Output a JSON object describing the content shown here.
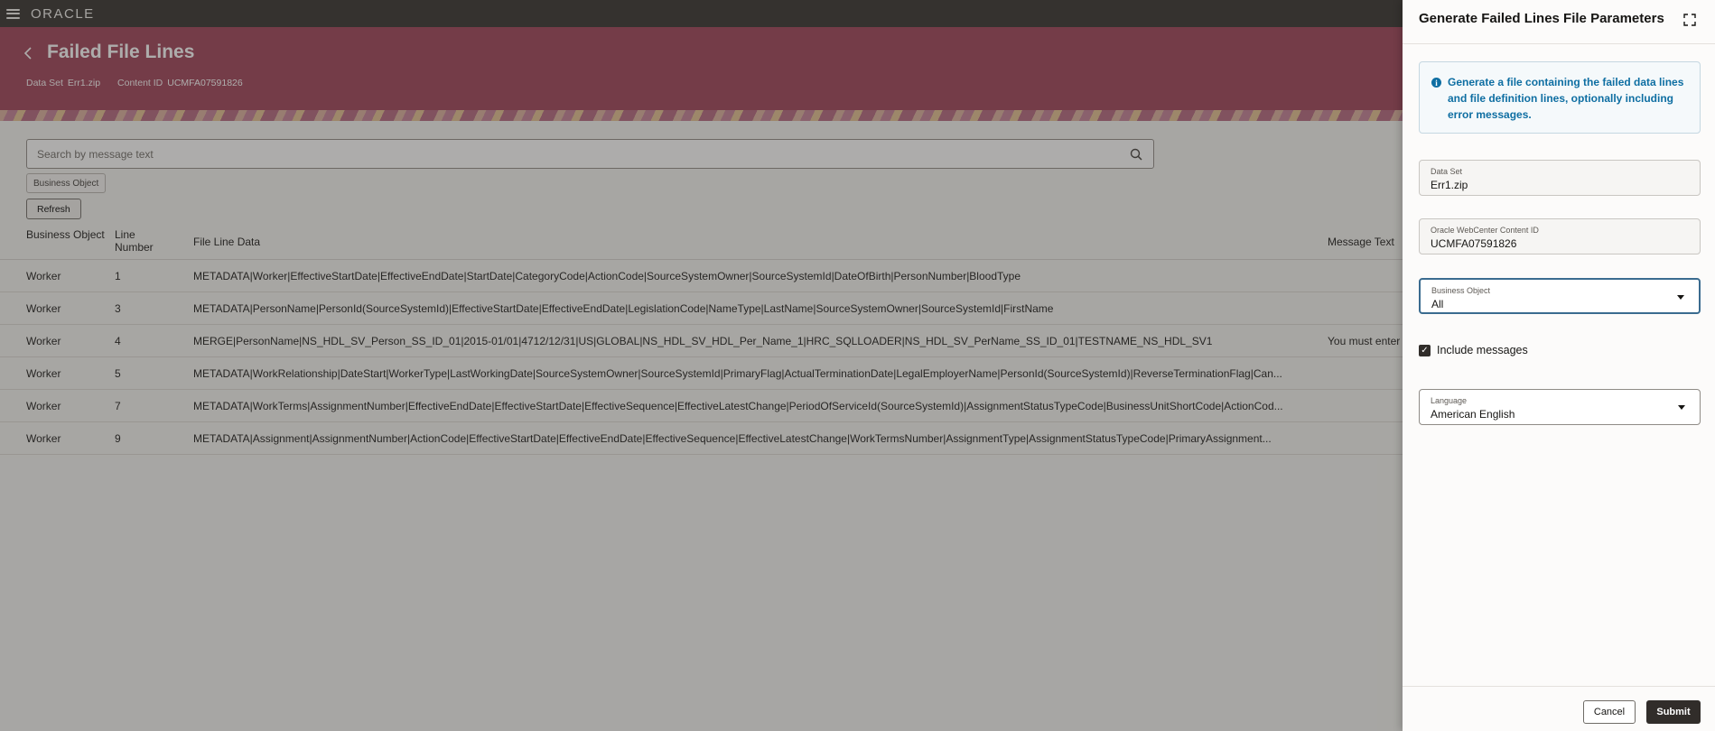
{
  "topbar": {
    "logo_text": "ORACLE"
  },
  "header": {
    "back_icon": "chevron-left-icon",
    "title": "Failed File Lines",
    "data_set_label": "Data Set",
    "data_set_value": "Err1.zip",
    "content_id_label": "Content ID",
    "content_id_value": "UCMFA07591826"
  },
  "search": {
    "placeholder": "Search by message text",
    "icon": "search-icon"
  },
  "filter_chip": "Business Object",
  "refresh_label": "Refresh",
  "table": {
    "headers": {
      "business_object": "Business Object",
      "line_number": "Line Number",
      "file_line_data": "File Line Data",
      "message_text": "Message Text"
    },
    "rows": [
      {
        "business_object": "Worker",
        "line_number": "1",
        "file_line_data": "METADATA|Worker|EffectiveStartDate|EffectiveEndDate|StartDate|CategoryCode|ActionCode|SourceSystemOwner|SourceSystemId|DateOfBirth|PersonNumber|BloodType",
        "message_text": ""
      },
      {
        "business_object": "Worker",
        "line_number": "3",
        "file_line_data": "METADATA|PersonName|PersonId(SourceSystemId)|EffectiveStartDate|EffectiveEndDate|LegislationCode|NameType|LastName|SourceSystemOwner|SourceSystemId|FirstName",
        "message_text": ""
      },
      {
        "business_object": "Worker",
        "line_number": "4",
        "file_line_data": "MERGE|PersonName|NS_HDL_SV_Person_SS_ID_01|2015-01/01|4712/12/31|US|GLOBAL|NS_HDL_SV_HDL_Per_Name_1|HRC_SQLLOADER|NS_HDL_SV_PerName_SS_ID_01|TESTNAME_NS_HDL_SV1",
        "message_text": "You must enter"
      },
      {
        "business_object": "Worker",
        "line_number": "5",
        "file_line_data": "METADATA|WorkRelationship|DateStart|WorkerType|LastWorkingDate|SourceSystemOwner|SourceSystemId|PrimaryFlag|ActualTerminationDate|LegalEmployerName|PersonId(SourceSystemId)|ReverseTerminationFlag|Can...",
        "message_text": ""
      },
      {
        "business_object": "Worker",
        "line_number": "7",
        "file_line_data": "METADATA|WorkTerms|AssignmentNumber|EffectiveEndDate|EffectiveStartDate|EffectiveSequence|EffectiveLatestChange|PeriodOfServiceId(SourceSystemId)|AssignmentStatusTypeCode|BusinessUnitShortCode|ActionCod...",
        "message_text": ""
      },
      {
        "business_object": "Worker",
        "line_number": "9",
        "file_line_data": "METADATA|Assignment|AssignmentNumber|ActionCode|EffectiveStartDate|EffectiveEndDate|EffectiveSequence|EffectiveLatestChange|WorkTermsNumber|AssignmentType|AssignmentStatusTypeCode|PrimaryAssignment...",
        "message_text": ""
      }
    ]
  },
  "drawer": {
    "title": "Generate Failed Lines File Parameters",
    "expand_icon": "expand-icon",
    "info_icon": "info-icon",
    "info_text": "Generate a file containing the failed data lines and file definition lines, optionally including error messages.",
    "fields": {
      "data_set": {
        "label": "Data Set",
        "value": "Err1.zip"
      },
      "content_id": {
        "label": "Oracle WebCenter Content ID",
        "value": "UCMFA07591826"
      },
      "business_object": {
        "label": "Business Object",
        "value": "All"
      },
      "language": {
        "label": "Language",
        "value": "American English"
      }
    },
    "include_messages": {
      "label": "Include messages",
      "checked": true
    },
    "cancel_label": "Cancel",
    "submit_label": "Submit"
  },
  "colors": {
    "topbar": "#312d2a",
    "banner": "#9e3f55",
    "info_accent": "#0e6ea2",
    "primary_button": "#312d2a"
  }
}
